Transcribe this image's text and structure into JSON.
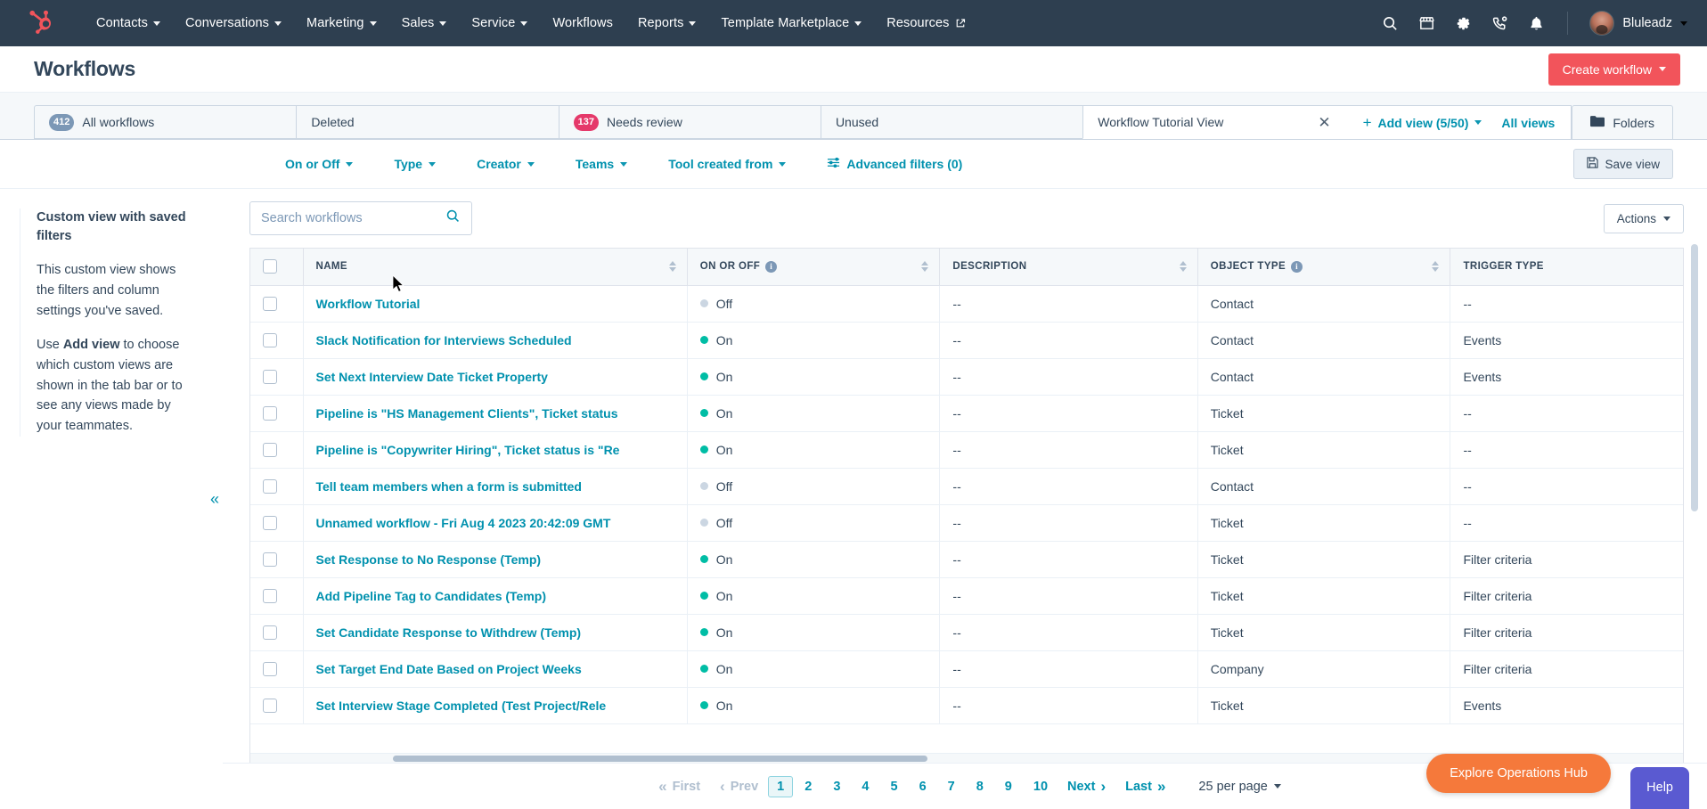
{
  "topnav": {
    "logo_icon": "hubspot-sprocket-logo",
    "items": [
      {
        "label": "Contacts",
        "has_caret": true
      },
      {
        "label": "Conversations",
        "has_caret": true
      },
      {
        "label": "Marketing",
        "has_caret": true
      },
      {
        "label": "Sales",
        "has_caret": true
      },
      {
        "label": "Service",
        "has_caret": true
      },
      {
        "label": "Workflows",
        "has_caret": false
      },
      {
        "label": "Reports",
        "has_caret": true
      },
      {
        "label": "Template Marketplace",
        "has_caret": true
      },
      {
        "label": "Resources",
        "has_caret": false,
        "external": true
      }
    ],
    "icons": [
      "search-icon",
      "marketplace-icon",
      "settings-gear-icon",
      "calling-icon",
      "notifications-bell-icon"
    ],
    "user": "Bluleadz"
  },
  "header": {
    "title": "Workflows",
    "create_button": "Create workflow"
  },
  "tabs": [
    {
      "label": "All workflows",
      "badge": "412",
      "badge_color": "#7c98b6",
      "active": false,
      "closable": false
    },
    {
      "label": "Deleted",
      "badge": null,
      "active": false,
      "closable": false
    },
    {
      "label": "Needs review",
      "badge": "137",
      "badge_color": "#e5396a",
      "active": false,
      "closable": false
    },
    {
      "label": "Unused",
      "badge": null,
      "active": false,
      "closable": false
    },
    {
      "label": "Workflow Tutorial View",
      "badge": null,
      "active": true,
      "closable": true
    }
  ],
  "tab_actions": {
    "add_view": "Add view (5/50)",
    "all_views": "All views",
    "folders": "Folders"
  },
  "filters": {
    "items": [
      "On or Off",
      "Type",
      "Creator",
      "Teams",
      "Tool created from"
    ],
    "advanced": "Advanced filters (0)",
    "save_view": "Save view"
  },
  "sidebar": {
    "title": "Custom view with saved filters",
    "paragraph1": "This custom view shows the filters and column settings you've saved.",
    "paragraph2_pre": "Use ",
    "paragraph2_bold": "Add view",
    "paragraph2_post": " to choose which custom views are shown in the tab bar or to see any views made by your teammates.",
    "collapse_icon": "chevron-double-left-icon"
  },
  "toolbar": {
    "search_placeholder": "Search workflows",
    "search_value": "",
    "actions_label": "Actions"
  },
  "table": {
    "columns": [
      "NAME",
      "ON OR OFF",
      "DESCRIPTION",
      "OBJECT TYPE",
      "TRIGGER TYPE"
    ],
    "rows": [
      {
        "name": "Workflow Tutorial",
        "state": "Off",
        "description": "--",
        "object": "Contact",
        "trigger": "--"
      },
      {
        "name": "Slack Notification for Interviews Scheduled",
        "state": "On",
        "description": "--",
        "object": "Contact",
        "trigger": "Events"
      },
      {
        "name": "Set Next Interview Date Ticket Property",
        "state": "On",
        "description": "--",
        "object": "Contact",
        "trigger": "Events"
      },
      {
        "name": "Pipeline is \"HS Management Clients\", Ticket status",
        "state": "On",
        "description": "--",
        "object": "Ticket",
        "trigger": "--"
      },
      {
        "name": "Pipeline is \"Copywriter Hiring\", Ticket status is \"Re",
        "state": "On",
        "description": "--",
        "object": "Ticket",
        "trigger": "--"
      },
      {
        "name": "Tell team members when a form is submitted",
        "state": "Off",
        "description": "--",
        "object": "Contact",
        "trigger": "--"
      },
      {
        "name": "Unnamed workflow - Fri Aug 4 2023 20:42:09 GMT",
        "state": "Off",
        "description": "--",
        "object": "Ticket",
        "trigger": "--"
      },
      {
        "name": "Set Response to No Response (Temp)",
        "state": "On",
        "description": "--",
        "object": "Ticket",
        "trigger": "Filter criteria"
      },
      {
        "name": "Add Pipeline Tag to Candidates (Temp)",
        "state": "On",
        "description": "--",
        "object": "Ticket",
        "trigger": "Filter criteria"
      },
      {
        "name": "Set Candidate Response to Withdrew (Temp)",
        "state": "On",
        "description": "--",
        "object": "Ticket",
        "trigger": "Filter criteria"
      },
      {
        "name": "Set Target End Date Based on Project Weeks",
        "state": "On",
        "description": "--",
        "object": "Company",
        "trigger": "Filter criteria"
      },
      {
        "name": "Set Interview Stage Completed (Test Project/Rele",
        "state": "On",
        "description": "--",
        "object": "Ticket",
        "trigger": "Events"
      }
    ]
  },
  "pagination": {
    "first": "First",
    "prev": "Prev",
    "pages": [
      "1",
      "2",
      "3",
      "4",
      "5",
      "6",
      "7",
      "8",
      "9",
      "10"
    ],
    "current_page": "1",
    "next": "Next",
    "last": "Last",
    "per_page": "25 per page"
  },
  "floating": {
    "ops_hub": "Explore Operations Hub",
    "help": "Help"
  }
}
